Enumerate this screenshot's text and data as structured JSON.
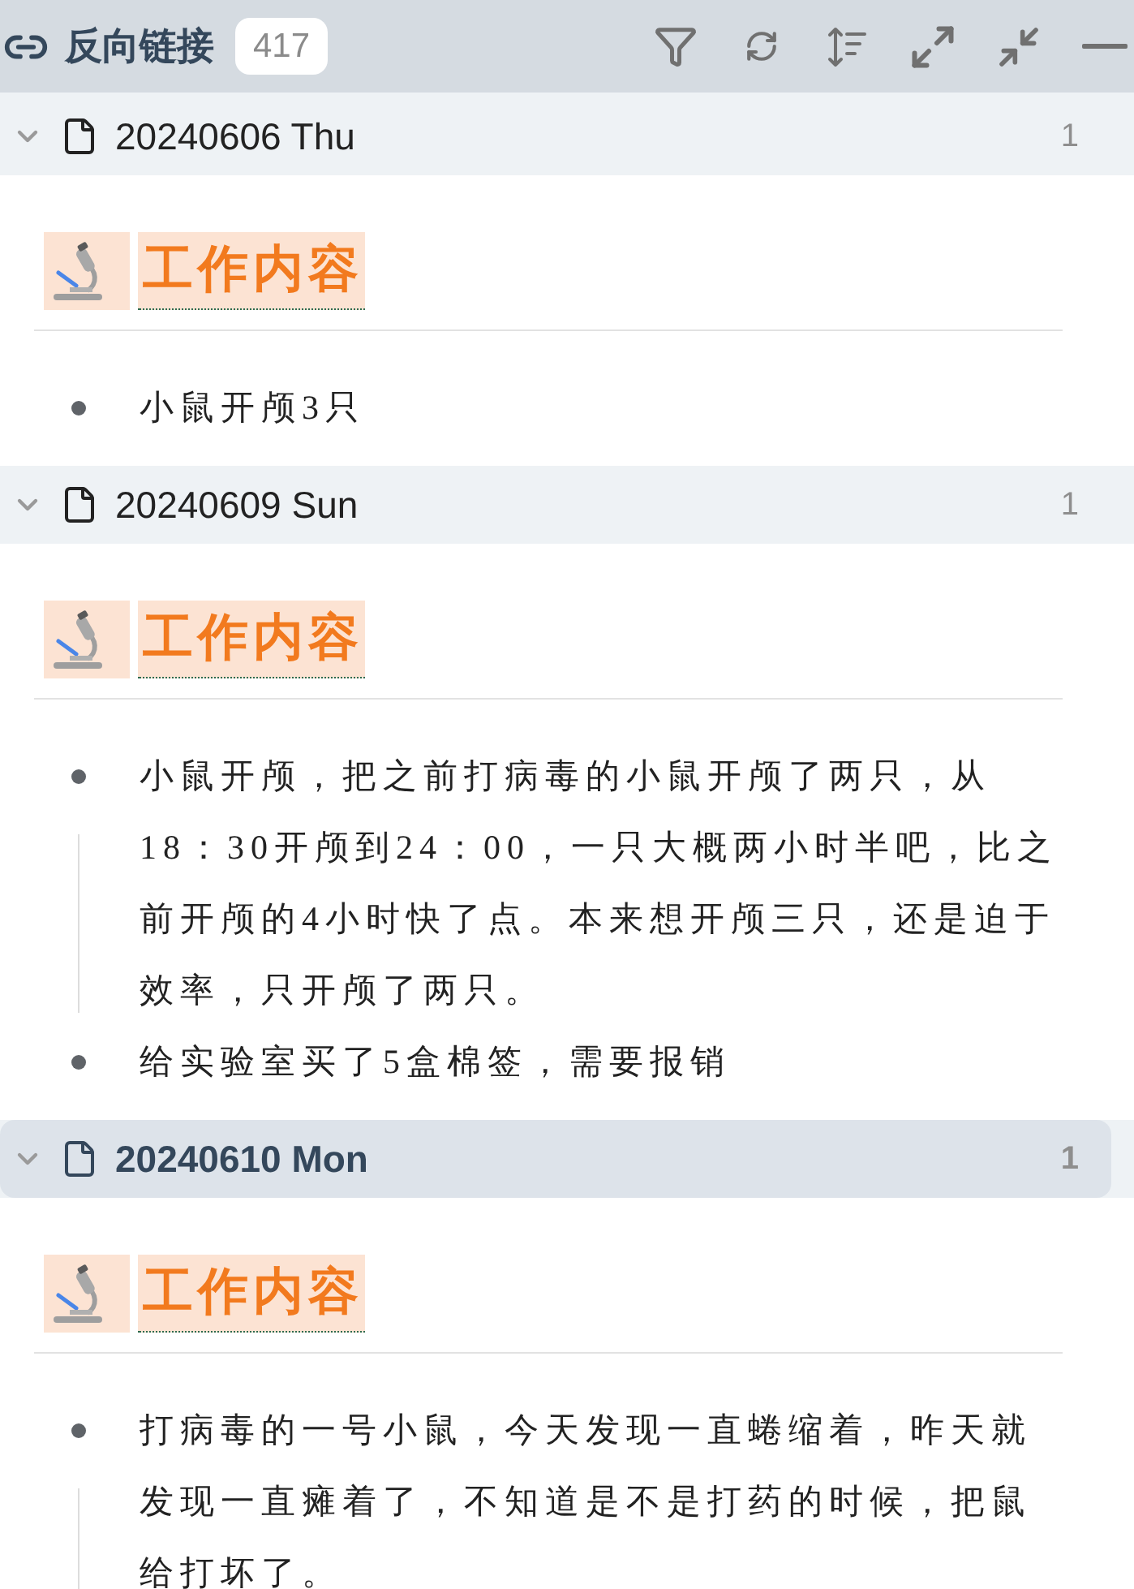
{
  "panel": {
    "title": "反向链接",
    "count": "417"
  },
  "groups": [
    {
      "title": "20240606 Thu",
      "count": "1",
      "expanded": true,
      "selected": false,
      "heading": "工作内容",
      "items": [
        "小鼠开颅3只"
      ]
    },
    {
      "title": "20240609 Sun",
      "count": "1",
      "expanded": true,
      "selected": false,
      "heading": "工作内容",
      "items": [
        "小鼠开颅，把之前打病毒的小鼠开颅了两只，从18：30开颅到24：00，一只大概两小时半吧，比之前开颅的4小时快了点。本来想开颅三只，还是迫于效率，只开颅了两只。",
        "给实验室买了5盒棉签，需要报销"
      ]
    },
    {
      "title": "20240610 Mon",
      "count": "1",
      "expanded": true,
      "selected": true,
      "heading": "工作内容",
      "items": [
        "打病毒的一号小鼠，今天发现一直蜷缩着，昨天就发现一直瘫着了，不知道是不是打药的时候，把鼠给打坏了。"
      ]
    }
  ]
}
